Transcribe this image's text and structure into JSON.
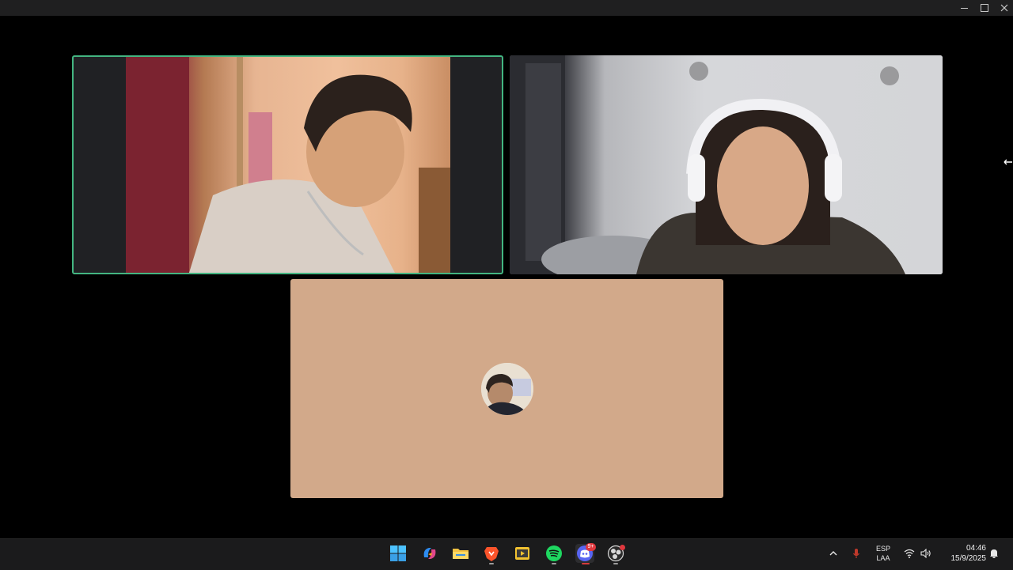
{
  "window": {
    "controls": {
      "minimize_icon": "minimize-icon",
      "maximize_icon": "maximize-icon",
      "close_icon": "close-icon"
    }
  },
  "call": {
    "participants": [
      {
        "tile": "video",
        "speaking": true,
        "speaking_color": "#43b581"
      },
      {
        "tile": "video",
        "speaking": false
      },
      {
        "tile": "avatar",
        "background": "#d2a98a"
      }
    ]
  },
  "taskbar": {
    "apps": [
      {
        "name": "start",
        "icon": "windows-start-icon"
      },
      {
        "name": "copilot",
        "icon": "copilot-icon"
      },
      {
        "name": "file-explorer",
        "icon": "folder-icon"
      },
      {
        "name": "brave",
        "icon": "brave-lion-icon"
      },
      {
        "name": "media-player",
        "icon": "media-player-icon"
      },
      {
        "name": "spotify",
        "icon": "spotify-icon"
      },
      {
        "name": "discord",
        "icon": "discord-icon",
        "badge": "9+"
      },
      {
        "name": "obs",
        "icon": "obs-icon"
      }
    ],
    "tray": {
      "chevron_icon": "chevron-up-icon",
      "mic_icon": "microphone-icon",
      "language_line1": "ESP",
      "language_line2": "LAA",
      "wifi_icon": "wifi-icon",
      "volume_icon": "volume-icon",
      "time": "04:46",
      "date": "15/9/2025",
      "notification_icon": "notification-bell-icon"
    }
  }
}
